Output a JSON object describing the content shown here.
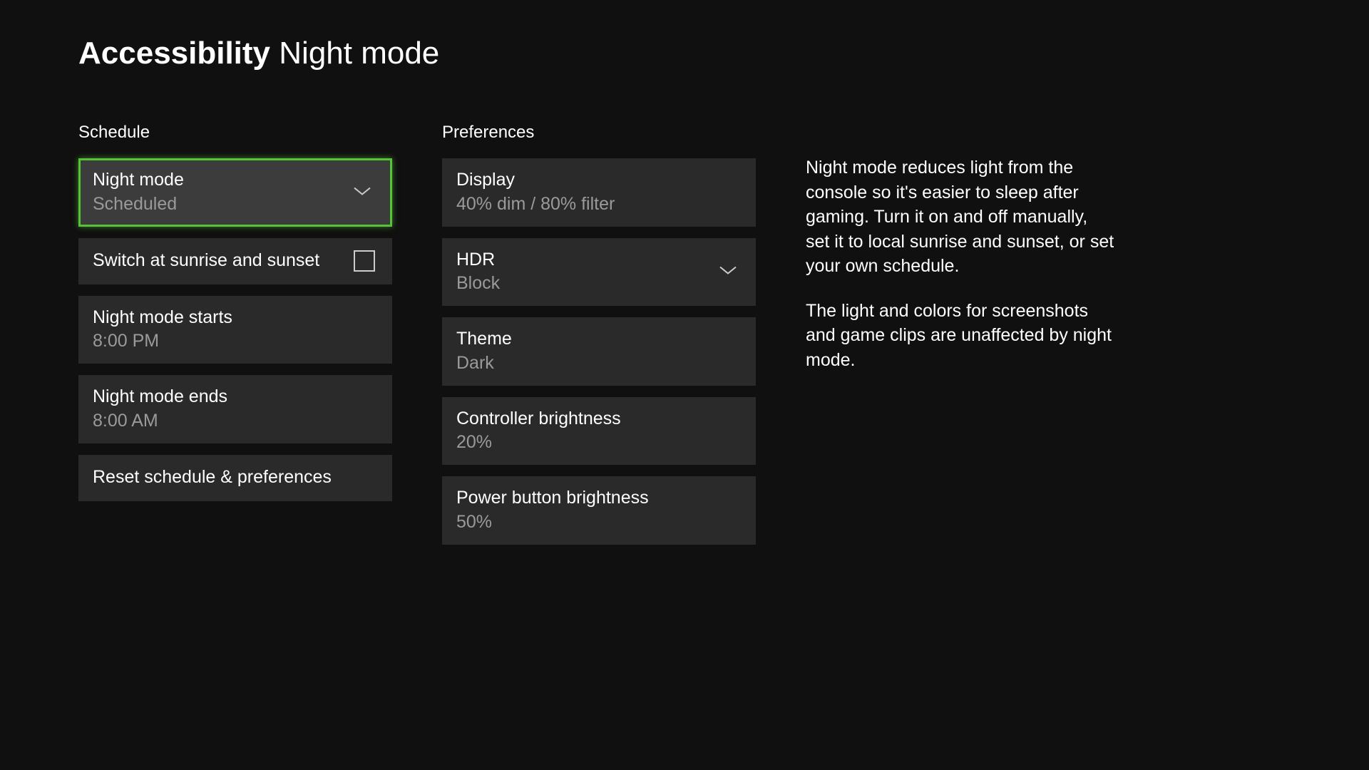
{
  "header": {
    "category": "Accessibility",
    "page": "Night mode"
  },
  "schedule": {
    "header": "Schedule",
    "night_mode": {
      "label": "Night mode",
      "value": "Scheduled"
    },
    "sunrise_sunset": {
      "label": "Switch at sunrise and sunset"
    },
    "starts": {
      "label": "Night mode starts",
      "value": "8:00 PM"
    },
    "ends": {
      "label": "Night mode ends",
      "value": "8:00 AM"
    },
    "reset": {
      "label": "Reset schedule & preferences"
    }
  },
  "preferences": {
    "header": "Preferences",
    "display": {
      "label": "Display",
      "value": "40% dim / 80% filter"
    },
    "hdr": {
      "label": "HDR",
      "value": "Block"
    },
    "theme": {
      "label": "Theme",
      "value": "Dark"
    },
    "controller": {
      "label": "Controller brightness",
      "value": "20%"
    },
    "power_button": {
      "label": "Power button brightness",
      "value": "50%"
    }
  },
  "description": {
    "p1": "Night mode reduces light from the console so it's easier to sleep after gaming. Turn it on and off manually, set it to local sunrise and sunset, or set your own schedule.",
    "p2": "The light and colors for screenshots and game clips are unaffected by night mode."
  }
}
